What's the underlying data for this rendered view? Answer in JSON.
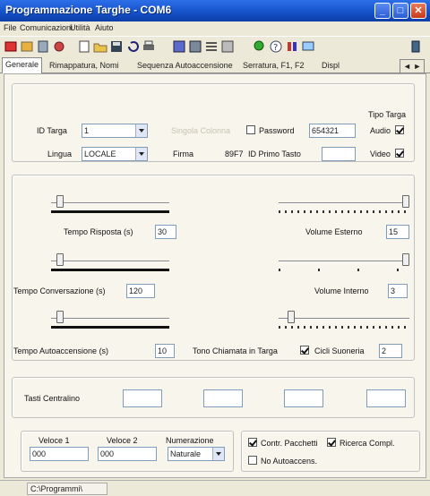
{
  "window": {
    "title": "Programmazione Targhe - COM6",
    "controls": [
      "minimize-icon",
      "maximize-icon",
      "close-icon"
    ]
  },
  "menu": [
    "File",
    "Comunicazioni",
    "Utilità",
    "Aiuto"
  ],
  "toolbar_icons": [
    "stop-icon",
    "run-icon",
    "device-icon",
    "connect-icon",
    "new-icon",
    "open-icon",
    "save-icon",
    "undo-icon",
    "print-icon",
    "grid-icon",
    "panel-icon",
    "list-icon",
    "table-icon",
    "search-icon",
    "help-icon",
    "settings-icon",
    "monitor-icon",
    "exit-icon"
  ],
  "tabs": [
    "Generale",
    "Rimappatura, Nomi",
    "Sequenza Autoaccensione",
    "Serratura, F1, F2",
    "Displ"
  ],
  "tabs_scroll": "◄ ►",
  "general": {
    "id_targa_label": "ID Targa",
    "id_targa_value": "1",
    "singola_colonna_label": "Singola Colonna",
    "password_label": "Password",
    "password_value": "654321",
    "lingua_label": "Lingua",
    "lingua_value": "LOCALE",
    "firma_label": "Firma",
    "firma_value": "89F7",
    "id_primo_tasto_label": "ID Primo Tasto",
    "id_primo_tasto_value": "",
    "tipo_targa_label": "Tipo Targa",
    "audio_label": "Audio",
    "video_label": "Video"
  },
  "timers": {
    "tempo_risposta_label": "Tempo Risposta (s)",
    "tempo_risposta_value": "30",
    "volume_esterno_label": "Volume Esterno",
    "volume_esterno_value": "15",
    "tempo_conversazione_label": "Tempo Conversazione (s)",
    "tempo_conversazione_value": "120",
    "volume_interno_label": "Volume Interno",
    "volume_interno_value": "3",
    "tempo_autoaccensione_label": "Tempo Autoaccensione (s)",
    "tempo_autoaccensione_value": "10",
    "tono_chiamata_label": "Tono Chiamata in Targa",
    "cicli_suoneria_label": "Cicli Suoneria",
    "cicli_suoneria_value": "2"
  },
  "centralino": {
    "label": "Tasti Centralino",
    "values": [
      "",
      "",
      "",
      ""
    ]
  },
  "bottom": {
    "veloce1_label": "Veloce 1",
    "veloce1_value": "000",
    "veloce2_label": "Veloce 2",
    "veloce2_value": "000",
    "numerazione_label": "Numerazione",
    "numerazione_value": "Naturale",
    "contr_pacchetti_label": "Contr. Pacchetti",
    "ricerca_compl_label": "Ricerca Compl.",
    "no_autoaccens_label": "No Autoaccens."
  },
  "status": {
    "path": "C:\\Programmi\\"
  },
  "colors": {
    "titlebar": "#1450c8",
    "panel": "#f7f5ec"
  }
}
